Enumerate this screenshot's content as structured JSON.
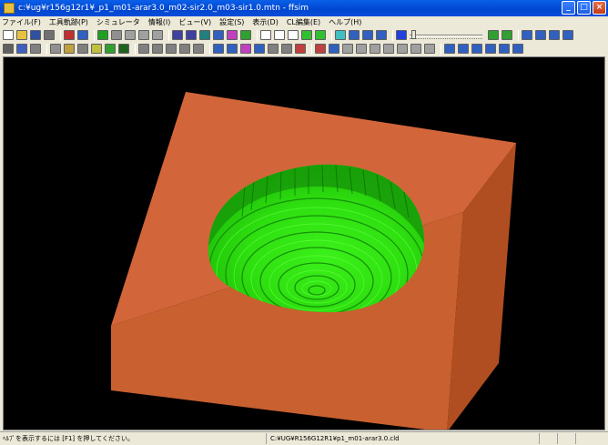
{
  "window": {
    "title": "c:¥ug¥r156g12r1¥_p1_m01-arar3.0_m02-sir2.0_m03-sir1.0.mtn - ffsim",
    "min_glyph": "_",
    "max_glyph": "□",
    "close_glyph": "×"
  },
  "menu": [
    "ファイル(F)",
    "工具軌跡(P)",
    "シミュレータ",
    "情報(I)",
    "ビュー(V)",
    "設定(S)",
    "表示(D)",
    "CL編集(E)",
    "ヘルプ(H)"
  ],
  "toolbar1": {
    "icons": [
      {
        "name": "new-file-icon",
        "color": "#ffffff"
      },
      {
        "name": "open-folder-icon",
        "color": "#e8c040"
      },
      {
        "name": "save-icon",
        "color": "#3050a0"
      },
      {
        "name": "print-icon",
        "color": "#707070"
      },
      {
        "name": "toolpath-view-icon",
        "color": "#c03030"
      },
      {
        "name": "material-view-icon",
        "color": "#3060c0"
      },
      {
        "name": "play-icon",
        "color": "#20a020"
      },
      {
        "name": "stop-icon",
        "color": "#909090"
      },
      {
        "name": "step-icon",
        "color": "#a0a0a0"
      },
      {
        "name": "cut-icon",
        "color": "#a0a0a0"
      },
      {
        "name": "measure-icon",
        "color": "#a0a0a0"
      },
      {
        "name": "cl-icon",
        "color": "#4040a0"
      },
      {
        "name": "cl2-icon",
        "color": "#4040a0"
      },
      {
        "name": "tool-icon",
        "color": "#208080"
      },
      {
        "name": "holder-icon",
        "color": "#3060c0"
      },
      {
        "name": "collision-icon",
        "color": "#c040c0"
      },
      {
        "name": "check-icon",
        "color": "#30a030"
      },
      {
        "name": "draw-1-icon",
        "color": "#ffffff"
      },
      {
        "name": "draw-2-icon",
        "color": "#ffffff"
      },
      {
        "name": "draw-3-icon",
        "color": "#ffffff"
      },
      {
        "name": "draw-4-icon",
        "color": "#30c030"
      },
      {
        "name": "draw-5-icon",
        "color": "#30c030"
      },
      {
        "name": "grid-icon",
        "color": "#40c0c0"
      },
      {
        "name": "list-icon",
        "color": "#3060c0"
      },
      {
        "name": "copy-icon",
        "color": "#3060c0"
      },
      {
        "name": "move-icon",
        "color": "#3060c0"
      },
      {
        "name": "fast-forward-icon",
        "color": "#2040e0"
      }
    ],
    "right_icons": [
      {
        "name": "material-green-icon",
        "color": "#30a030"
      },
      {
        "name": "material-red-icon",
        "color": "#30a030"
      },
      {
        "name": "view-fit-icon",
        "color": "#3060c0"
      },
      {
        "name": "view-iso-icon",
        "color": "#3060c0"
      },
      {
        "name": "view-rotate-icon",
        "color": "#3060c0"
      },
      {
        "name": "zoom-in-icon",
        "color": "#3060c0"
      }
    ]
  },
  "toolbar2": {
    "icons": [
      {
        "name": "cursor-icon",
        "color": "#606060"
      },
      {
        "name": "select-icon",
        "color": "#4060c0"
      },
      {
        "name": "filter-icon",
        "color": "#808080"
      },
      {
        "name": "sphere-icon",
        "color": "#909090"
      },
      {
        "name": "color-1-icon",
        "color": "#c0a040"
      },
      {
        "name": "color-2-icon",
        "color": "#808080"
      },
      {
        "name": "color-3-icon",
        "color": "#c0c040"
      },
      {
        "name": "color-4-icon",
        "color": "#30a030"
      },
      {
        "name": "color-5-icon",
        "color": "#206020"
      },
      {
        "name": "line-1-icon",
        "color": "#808080"
      },
      {
        "name": "line-2-icon",
        "color": "#808080"
      },
      {
        "name": "line-3-icon",
        "color": "#808080"
      },
      {
        "name": "next-icon",
        "color": "#808080"
      },
      {
        "name": "stop2-icon",
        "color": "#808080"
      },
      {
        "name": "table-icon",
        "color": "#3060c0"
      },
      {
        "name": "table2-icon",
        "color": "#3060c0"
      },
      {
        "name": "table3-icon",
        "color": "#c040c0"
      },
      {
        "name": "funnel-icon",
        "color": "#3060c0"
      },
      {
        "name": "grid2-icon",
        "color": "#808080"
      },
      {
        "name": "grid3-icon",
        "color": "#808080"
      },
      {
        "name": "remove-icon",
        "color": "#c04040"
      },
      {
        "name": "panel-1-icon",
        "color": "#c04040"
      },
      {
        "name": "panel-2-icon",
        "color": "#3060c0"
      },
      {
        "name": "panel-3-icon",
        "color": "#a0a0a0"
      },
      {
        "name": "panel-4-icon",
        "color": "#a0a0a0"
      },
      {
        "name": "panel-5-icon",
        "color": "#a0a0a0"
      },
      {
        "name": "panel-6-icon",
        "color": "#a0a0a0"
      },
      {
        "name": "panel-7-icon",
        "color": "#a0a0a0"
      },
      {
        "name": "panel-8-icon",
        "color": "#a0a0a0"
      },
      {
        "name": "panel-9-icon",
        "color": "#a0a0a0"
      },
      {
        "name": "axis-x-icon",
        "color": "#3060c0"
      },
      {
        "name": "axis-y-icon",
        "color": "#3060c0"
      },
      {
        "name": "axis-z-icon",
        "color": "#3060c0"
      },
      {
        "name": "axis-w-icon",
        "color": "#3060c0"
      },
      {
        "name": "axis-u-icon",
        "color": "#3060c0"
      },
      {
        "name": "axis-v-icon",
        "color": "#3060c0"
      }
    ]
  },
  "viewport": {
    "background": "#000000",
    "block_top_color": "#d2663a",
    "block_left_color": "#c8602f",
    "block_right_color": "#b04e22",
    "pocket_color": "#2fe010",
    "pocket_dark": "#169208"
  },
  "status": {
    "help_text": "ﾍﾙﾌﾟを表示するには [F1] を押してください。",
    "file_text": "C:¥UG¥R156G12R1¥p1_m01-arar3.0.cld"
  }
}
